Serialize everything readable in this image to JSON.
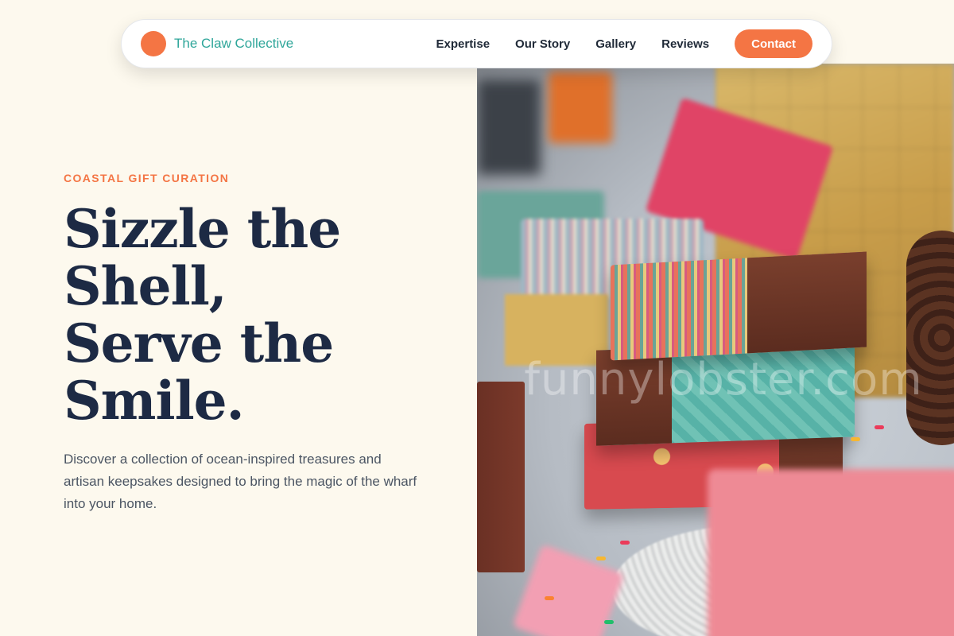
{
  "nav": {
    "brand_name": "The Claw Collective",
    "links": [
      "Expertise",
      "Our Story",
      "Gallery",
      "Reviews"
    ],
    "contact_label": "Contact"
  },
  "hero": {
    "eyebrow": "COASTAL GIFT CURATION",
    "headline_lines": [
      "Sizzle the",
      "Shell,",
      "Serve the",
      "Smile."
    ],
    "description": "Discover a collection of ocean-inspired treasures and artisan keepsakes designed to bring the magic of the wharf into your home."
  },
  "image": {
    "watermark": "funnylobster.com"
  },
  "colors": {
    "accent": "#f47544",
    "brand_text": "#2fa69a",
    "headline": "#1d2a44",
    "background": "#fdf9ee"
  }
}
